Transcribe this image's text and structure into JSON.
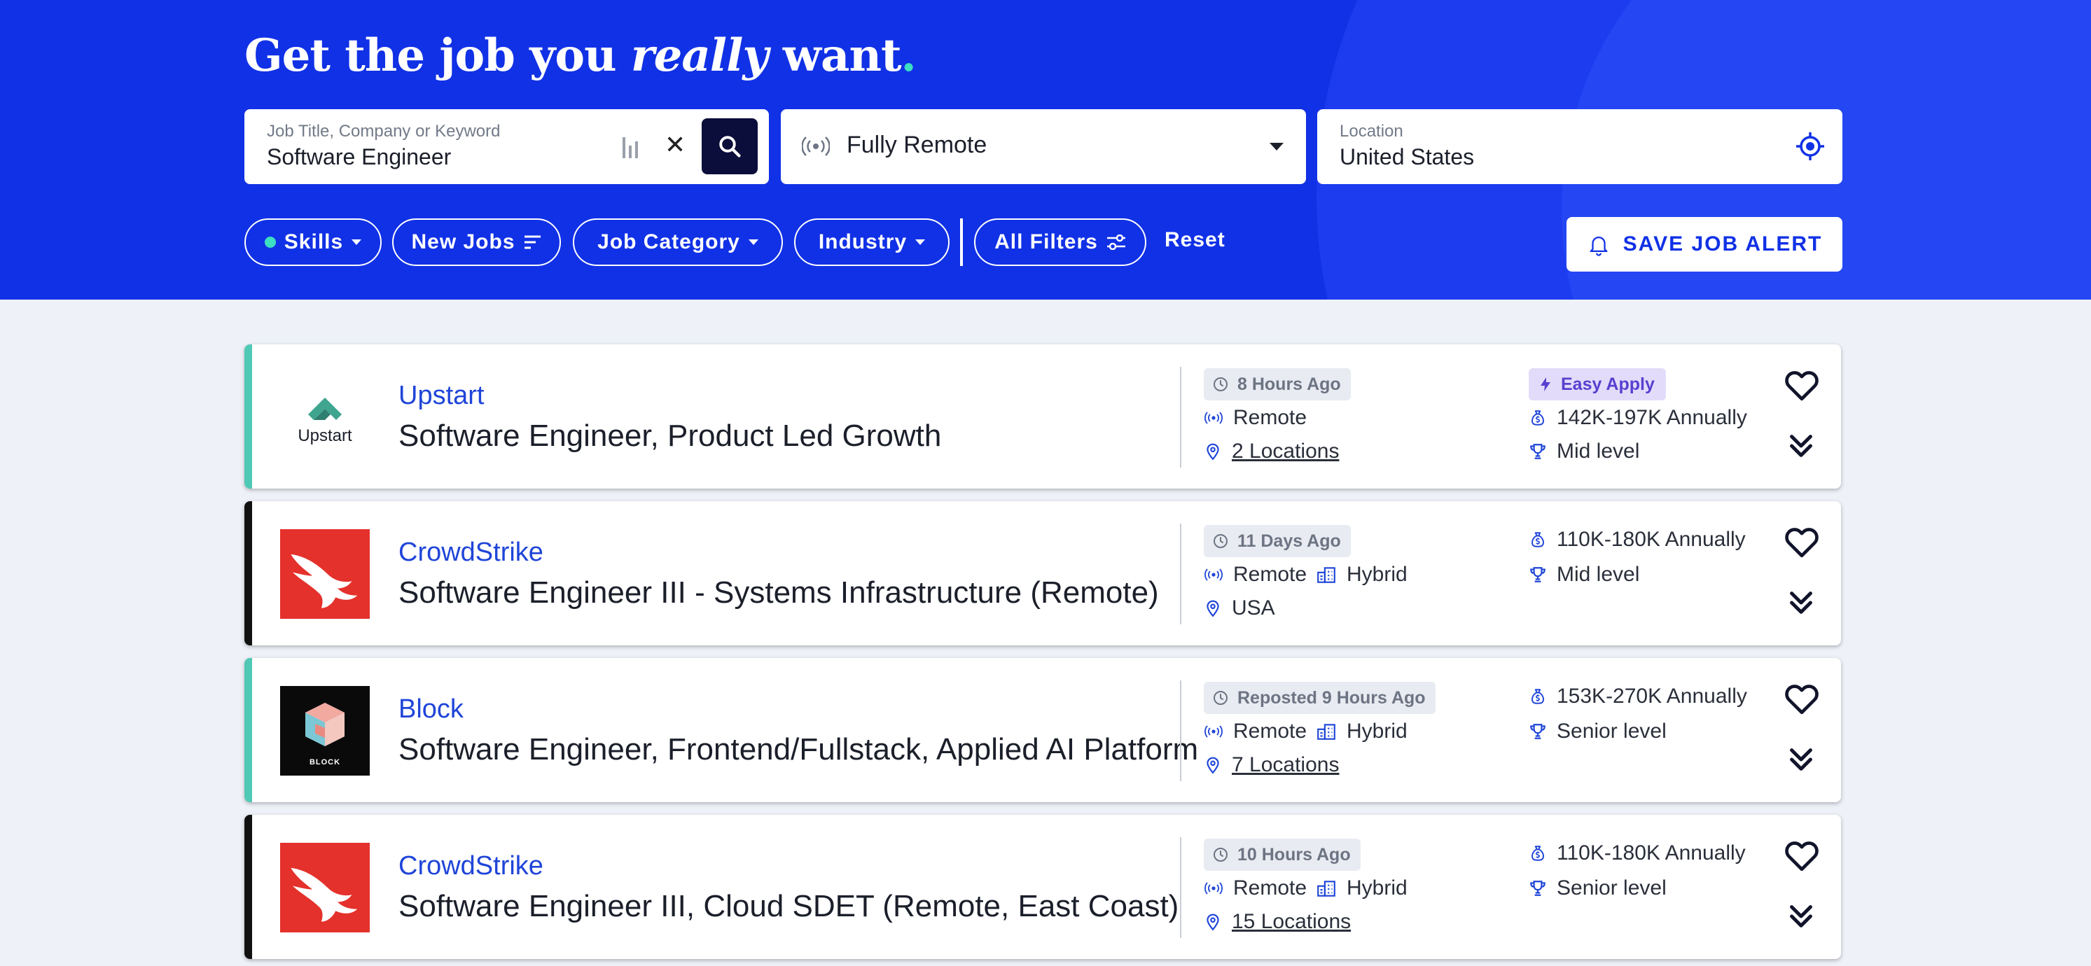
{
  "hero": {
    "headline_part1": "Get the job you ",
    "headline_em": "really",
    "headline_part2": " want",
    "headline_dot": "."
  },
  "search": {
    "keyword_label": "Job Title, Company or Keyword",
    "keyword_value": "Software Engineer",
    "remote_value": "Fully Remote",
    "location_label": "Location",
    "location_value": "United States"
  },
  "filters": {
    "skills": "Skills",
    "new_jobs": "New Jobs",
    "job_category": "Job Category",
    "industry": "Industry",
    "all_filters": "All Filters",
    "reset": "Reset",
    "save_alert": "SAVE JOB ALERT"
  },
  "colors": {
    "brand_blue": "#1131e6",
    "accent_teal": "#3ddfc3",
    "crowdstrike_red": "#e4312b"
  },
  "jobs": [
    {
      "company": "Upstart",
      "logo_text": "Upstart",
      "title": "Software Engineer, Product Led Growth",
      "posted": "8 Hours Ago",
      "easy_apply": "Easy Apply",
      "work_type": "Remote",
      "location": "2 Locations",
      "salary": "142K-197K Annually",
      "level": "Mid level"
    },
    {
      "company": "CrowdStrike",
      "title": "Software Engineer III - Systems Infrastructure (Remote)",
      "posted": "11 Days Ago",
      "work_type": "Remote",
      "work_type2": "Hybrid",
      "location": "USA",
      "salary": "110K-180K Annually",
      "level": "Mid level"
    },
    {
      "company": "Block",
      "logo_text": "BLOCK",
      "title": "Software Engineer, Frontend/Fullstack, Applied AI Platform",
      "posted": "Reposted 9 Hours Ago",
      "work_type": "Remote",
      "work_type2": "Hybrid",
      "location": "7 Locations",
      "salary": "153K-270K Annually",
      "level": "Senior level"
    },
    {
      "company": "CrowdStrike",
      "title": "Software Engineer III, Cloud SDET (Remote, East Coast)",
      "posted": "10 Hours Ago",
      "work_type": "Remote",
      "work_type2": "Hybrid",
      "location": "15 Locations",
      "salary": "110K-180K Annually",
      "level": "Senior level"
    }
  ]
}
